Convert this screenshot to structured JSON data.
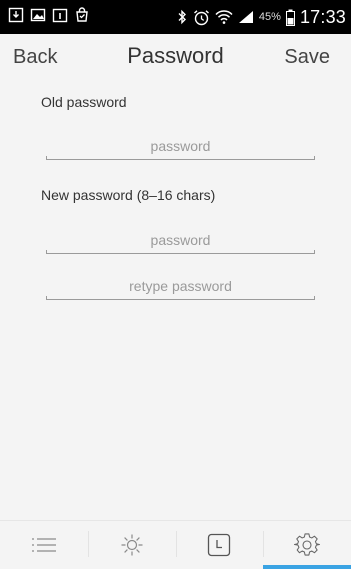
{
  "statusbar": {
    "battery_percent": "45%",
    "time": "17:33",
    "left_icons": [
      "download-icon",
      "image-icon",
      "calendar-icon",
      "shopping-bag-icon"
    ],
    "right_icons": [
      "bluetooth-icon",
      "alarm-icon",
      "wifi-icon",
      "signal-icon",
      "battery-icon"
    ]
  },
  "header": {
    "back_label": "Back",
    "title": "Password",
    "save_label": "Save"
  },
  "form": {
    "old_password": {
      "label": "Old password",
      "placeholder": "password",
      "value": ""
    },
    "new_password": {
      "label": "New password (8–16 chars)",
      "placeholder": "password",
      "value": "",
      "retype_placeholder": "retype password",
      "retype_value": ""
    }
  },
  "tabbar": {
    "tabs": [
      {
        "icon": "list-icon",
        "active": false
      },
      {
        "icon": "sun-icon",
        "active": false
      },
      {
        "icon": "clock-icon",
        "active": false
      },
      {
        "icon": "gear-icon",
        "active": true
      }
    ],
    "accent_color": "#3aa3e3"
  }
}
